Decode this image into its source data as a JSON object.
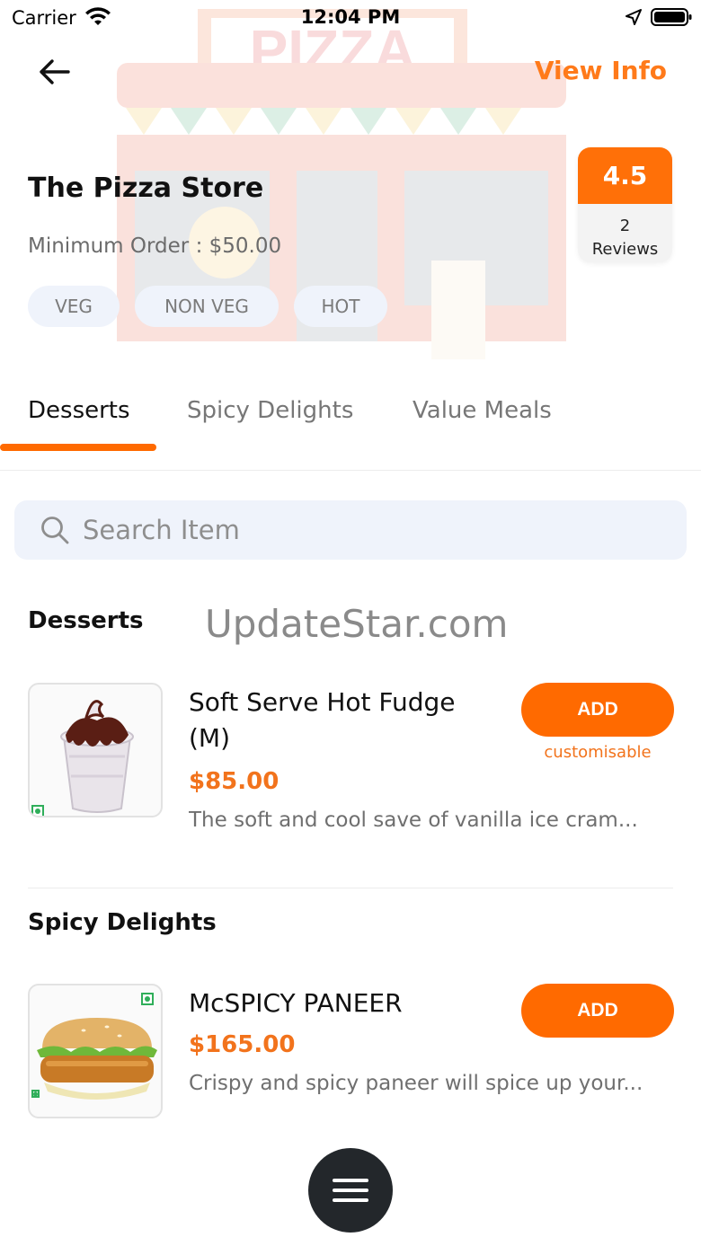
{
  "status_bar": {
    "carrier": "Carrier",
    "time": "12:04 PM"
  },
  "header": {
    "back_icon": "arrow-left-icon",
    "view_info_label": "View Info",
    "store_name": "The Pizza Store",
    "min_order": "Minimum Order : $50.00",
    "tags": [
      "VEG",
      "NON VEG",
      "HOT"
    ],
    "rating": {
      "value": "4.5",
      "count": "2",
      "count_label": "Reviews"
    },
    "hero_sign_text": "PIZZA"
  },
  "tabs": [
    {
      "label": "Desserts",
      "active": true
    },
    {
      "label": "Spicy Delights",
      "active": false
    },
    {
      "label": "Value Meals",
      "active": false
    }
  ],
  "search": {
    "placeholder": "Search Item",
    "value": ""
  },
  "watermark": "UpdateStar.com",
  "sections": [
    {
      "title": "Desserts",
      "items": [
        {
          "name": "Soft Serve Hot Fudge (M)",
          "price": "$85.00",
          "description": "The soft and cool save of vanilla ice cram...",
          "add_label": "ADD",
          "note": "customisable",
          "image": "sundae-image"
        }
      ]
    },
    {
      "title": "Spicy Delights",
      "items": [
        {
          "name": "McSPICY PANEER",
          "price": "$165.00",
          "description": "Crispy and spicy paneer will spice up your...",
          "add_label": "ADD",
          "image": "burger-image"
        }
      ]
    }
  ],
  "colors": {
    "accent": "#ff6a00",
    "price": "#f2731c",
    "veg_mark": "#2fae5a",
    "fab": "#23272b"
  },
  "fab_icon": "hamburger-menu-icon"
}
